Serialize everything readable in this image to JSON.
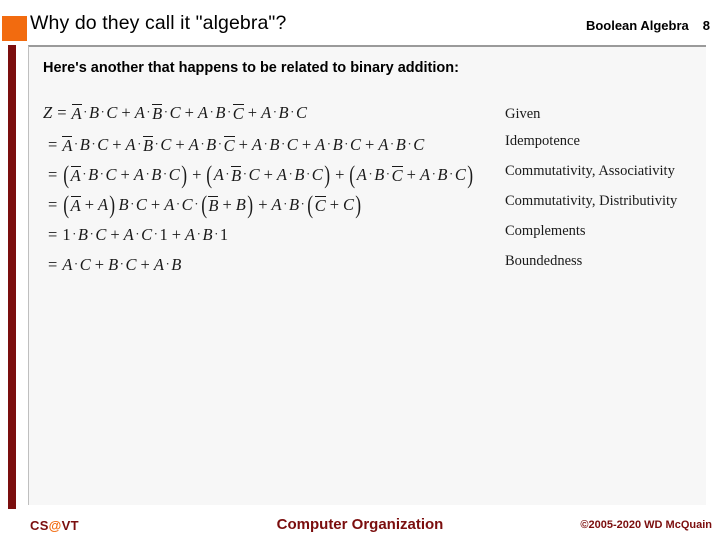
{
  "header": {
    "title": "Why do they call it \"algebra\"?",
    "topic": "Boolean Algebra",
    "slide_number": "8",
    "bullet_color": "#F26B0F"
  },
  "accent": {
    "bar_color": "#7B0E0E",
    "panel_bg": "#F7F7F7",
    "panel_border": "#BFBFBF"
  },
  "body": {
    "intro_text": "Here's another that happens to be related to binary addition:"
  },
  "derivation": {
    "variable": "Z",
    "rows": [
      {
        "lhs": "Z",
        "eq": "=",
        "expr_text": "Ā·B·C + A·B̄·C + A·B·C̄ + A·B·C",
        "reason": "Given"
      },
      {
        "lhs": "",
        "eq": "=",
        "expr_text": "Ā·B·C + A·B̄·C + A·B·C̄ + A·B·C + A·B·C + A·B·C",
        "reason": "Idempotence"
      },
      {
        "lhs": "",
        "eq": "=",
        "expr_text": "(Ā·B·C + A·B·C) + (A·B̄·C + A·B·C) + (A·B·C̄ + A·B·C)",
        "reason": "Commutativity, Associativity"
      },
      {
        "lhs": "",
        "eq": "=",
        "expr_text": "(Ā + A)·B·C + A·C·(B̄ + B) + A·B·(C̄ + C)",
        "reason": "Commutativity, Distributivity"
      },
      {
        "lhs": "",
        "eq": "=",
        "expr_text": "1·B·C + A·C·1 + A·B·1",
        "reason": "Complements"
      },
      {
        "lhs": "",
        "eq": "=",
        "expr_text": "A·C + B·C + A·B",
        "reason": "Boundedness"
      }
    ]
  },
  "footer": {
    "logo_cs": "CS",
    "logo_at": "@",
    "logo_vt": "VT",
    "center": "Computer Organization",
    "copyright": "©2005-2020 WD McQuain"
  }
}
